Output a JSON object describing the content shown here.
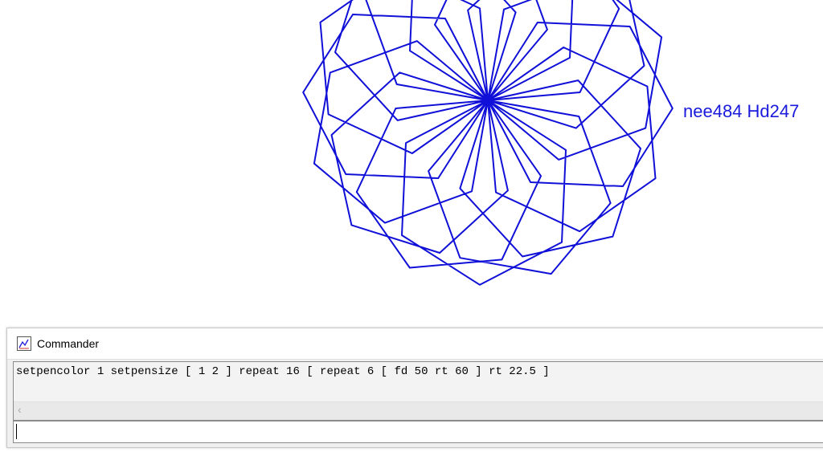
{
  "canvas": {
    "label": "nee484 Hd247",
    "pen_color": "#1010d8",
    "drawing": {
      "repeat_outer": 16,
      "repeat_inner": 6,
      "forward": 50,
      "inner_turn": 60,
      "outer_turn": 22.5
    }
  },
  "commander": {
    "title": "Commander",
    "history": "setpencolor 1 setpensize [ 1 2 ] repeat 16 [ repeat 6 [ fd 50 rt 60 ] rt 22.5 ]",
    "input_value": "",
    "scroll_left_icon": "‹"
  }
}
